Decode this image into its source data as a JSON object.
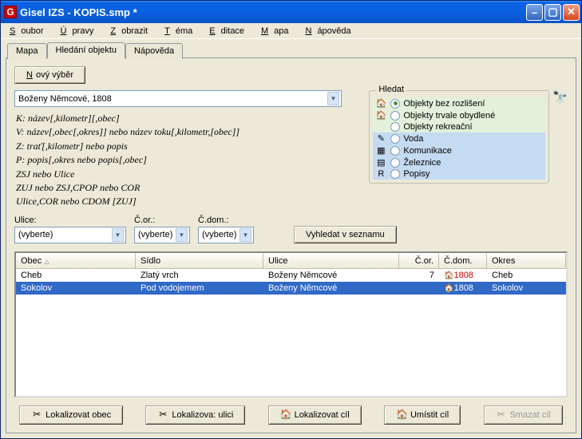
{
  "title": "Gisel IZS - KOPIS.smp *",
  "menu": [
    "Soubor",
    "Úpravy",
    "Zobrazit",
    "Téma",
    "Editace",
    "Mapa",
    "Nápověda"
  ],
  "tabs": {
    "t0": "Mapa",
    "t1": "Hledání objektu",
    "t2": "Nápověda"
  },
  "novy": "Nový výběr",
  "combo_main": "Boženy Němcové, 1808",
  "hints": {
    "k": "K: název[,kilometr][,obec]",
    "v": "V: název[,obec[,okres]] nebo  název toku[,kilometr,[obec]]",
    "z": "Z: trať[,kilometr]  nebo  popis",
    "p": "P: popis[,okres  nebo  popis[,obec]",
    "zsj": "ZSJ nebo Ulice",
    "zuj": "ZUJ nebo ZSJ,CPOP  nebo  COR",
    "ulice": "Ulice,COR  nebo  CDOM [ZUJ]"
  },
  "hledat": {
    "legend": "Hledat",
    "rows": [
      {
        "icon": "🏠",
        "label": "Objekty bez rozlišení",
        "checked": true,
        "grp": 1
      },
      {
        "icon": "🏠",
        "label": "Objekty trvale obydlené",
        "checked": false,
        "grp": 1
      },
      {
        "icon": "",
        "label": "Objekty rekreační",
        "checked": false,
        "grp": 1
      },
      {
        "icon": "✎",
        "label": "Voda",
        "checked": false,
        "grp": 2
      },
      {
        "icon": "▦",
        "label": "Komunikace",
        "checked": false,
        "grp": 2
      },
      {
        "icon": "▤",
        "label": "Železnice",
        "checked": false,
        "grp": 2
      },
      {
        "icon": "R",
        "label": "Popisy",
        "checked": false,
        "grp": 2
      }
    ]
  },
  "mid": {
    "ulice_lbl": "Ulice:",
    "cor_lbl": "Č.or.:",
    "cdom_lbl": "Č.dom.:",
    "placeholder": "(vyberte)",
    "vyhledat": "Vyhledat v seznamu"
  },
  "table": {
    "cols": [
      "Obec",
      "Sídlo",
      "Ulice",
      "Č.or.",
      "Č.dom.",
      "Okres"
    ],
    "rows": [
      {
        "obec": "Cheb",
        "sidlo": "Zlatý vrch",
        "ulice": "Boženy Němcové",
        "cor": "7",
        "cdom": "1808",
        "okres": "Cheb",
        "sel": false
      },
      {
        "obec": "Sokolov",
        "sidlo": "Pod vodojemem",
        "ulice": "Boženy Němcové",
        "cor": "",
        "cdom": "1808",
        "okres": "Sokolov",
        "sel": true
      }
    ]
  },
  "bottom": {
    "b1": "Lokalizovat obec",
    "b2": "Lokalizova: ulici",
    "b3": "Lokalizovat cíl",
    "b4": "Umístit cíl",
    "b5": "Smazat cíl"
  }
}
